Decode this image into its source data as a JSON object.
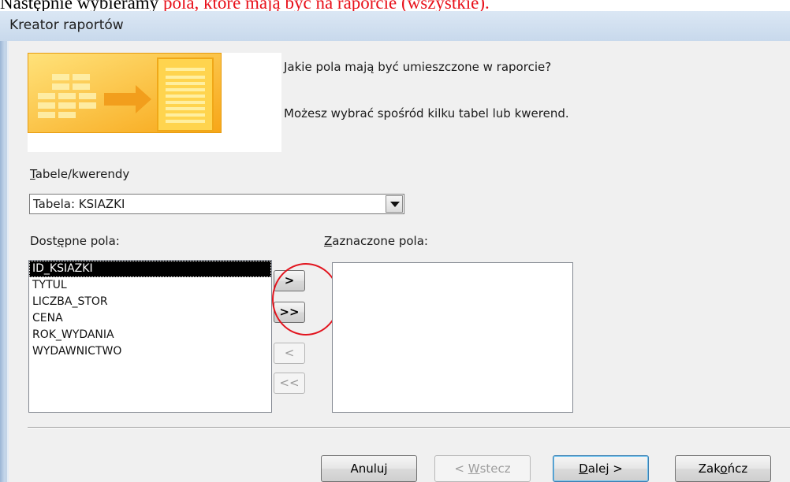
{
  "document": {
    "instruction_partial": "Następnie wybieramy pola, które mają być na raporcie (wszystkie).",
    "instruction_black_prefix": "Następnie wybieramy ",
    "instruction_red_rest": "pola, które mają być na raporcie (wszystkie)."
  },
  "window": {
    "title": "Kreator raportów"
  },
  "header": {
    "question": "Jakie pola mają być umieszczone w raporcie?",
    "hint": "Możesz wybrać spośród kilku tabel lub kwerend."
  },
  "tables_queries": {
    "label_accel": "T",
    "label_rest": "abele/kwerendy",
    "selected_value": "Tabela: KSIAZKI"
  },
  "available_fields": {
    "label_pre": "Dost",
    "label_accel": "ę",
    "label_post": "pne pola:",
    "items": [
      "ID_KSIAZKI",
      "TYTUL",
      "LICZBA_STOR",
      "CENA",
      "ROK_WYDANIA",
      "WYDAWNICTWO"
    ],
    "selected_item": "ID_KSIAZKI"
  },
  "selected_fields": {
    "label_accel": "Z",
    "label_rest": "aznaczone pola:",
    "items": []
  },
  "move_buttons": {
    "add_one": ">",
    "add_all": ">>",
    "remove_one": "<",
    "remove_all": "<<"
  },
  "footer": {
    "cancel": "Anuluj",
    "back_pre": "< ",
    "back_accel": "W",
    "back_post": "stecz",
    "next_accel": "D",
    "next_post": "alej >",
    "finish_pre": "Zak",
    "finish_accel": "o",
    "finish_post": "ńcz"
  },
  "colors": {
    "annotation_red": "#e2141e",
    "instruction_red": "#e8101a",
    "selection": "#000000"
  }
}
